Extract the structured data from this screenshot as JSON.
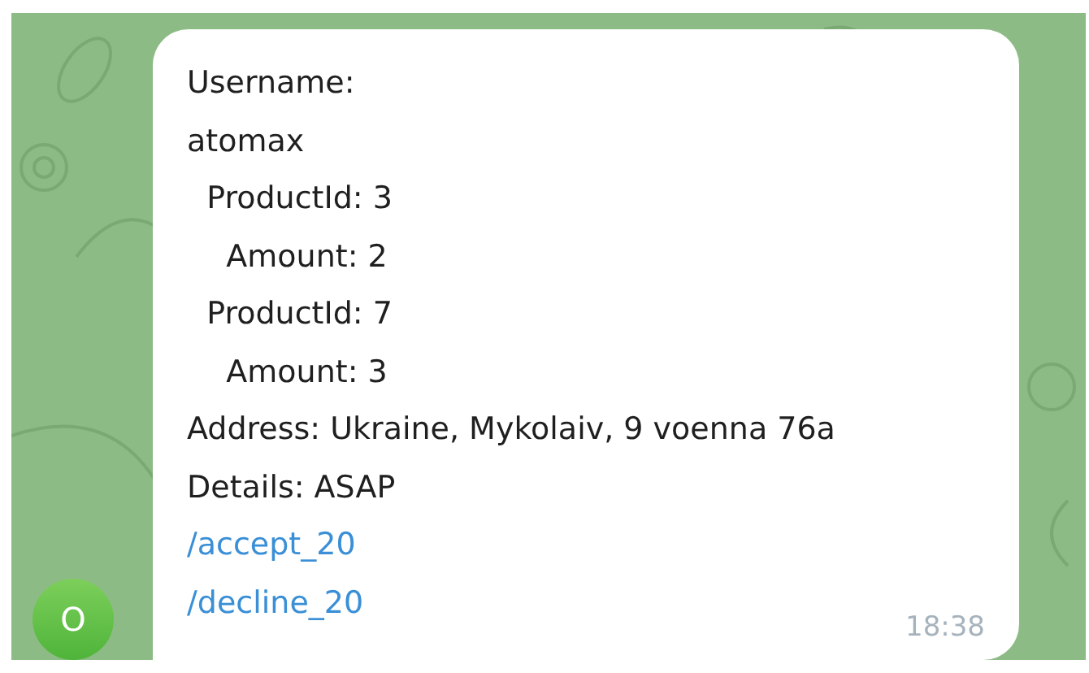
{
  "message": {
    "lines": [
      {
        "kind": "text",
        "text": "Username:"
      },
      {
        "kind": "text",
        "text": "atomax"
      },
      {
        "kind": "text",
        "text": "  ProductId: 3"
      },
      {
        "kind": "text",
        "text": "    Amount: 2"
      },
      {
        "kind": "text",
        "text": "  ProductId: 7"
      },
      {
        "kind": "text",
        "text": "    Amount: 3"
      },
      {
        "kind": "text",
        "text": "Address: Ukraine, Mykolaiv, 9 voenna 76a"
      },
      {
        "kind": "text",
        "text": "Details: ASAP"
      },
      {
        "kind": "command",
        "text": "/accept_20"
      },
      {
        "kind": "command",
        "text": "/decline_20"
      }
    ],
    "time": "18:38"
  },
  "avatar": {
    "letter": "O"
  }
}
